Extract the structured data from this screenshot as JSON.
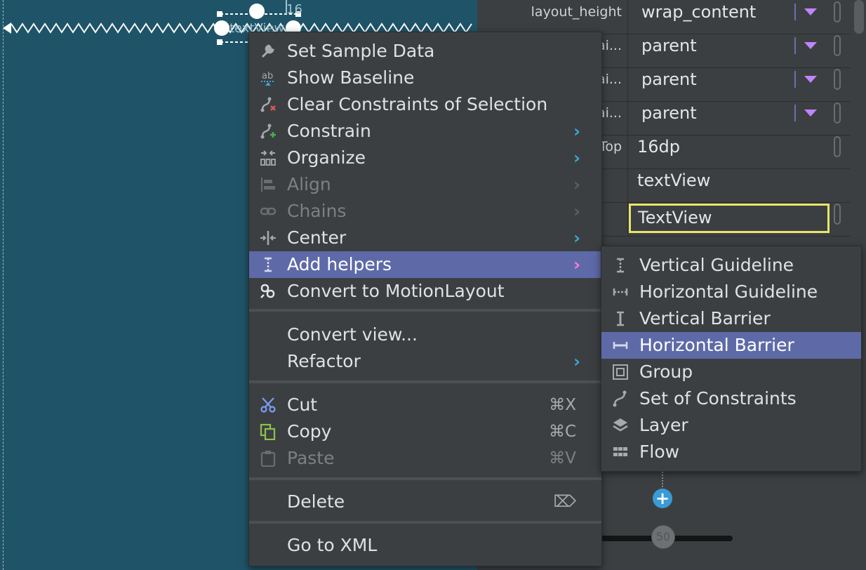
{
  "canvas": {
    "selected_label": "textView",
    "margin_label": "16"
  },
  "properties": {
    "rows": [
      {
        "name": "layout_height",
        "value": "wrap_content",
        "dropdown": true,
        "pill": true
      },
      {
        "name": "ai...",
        "value": "parent",
        "dropdown": true,
        "pill": true
      },
      {
        "name": "ai...",
        "value": "parent",
        "dropdown": true,
        "pill": true
      },
      {
        "name": "ai...",
        "value": "parent",
        "dropdown": true,
        "pill": true
      },
      {
        "name": "Top",
        "value": "16dp",
        "dropdown": false,
        "pill": true
      },
      {
        "name": "",
        "value": "textView",
        "dropdown": false,
        "pill": false
      },
      {
        "name": "",
        "value": "TextView",
        "dropdown": false,
        "pill": true,
        "editing": true
      }
    ],
    "slider_value": "50",
    "add_symbol": "+"
  },
  "context_menu": {
    "items": [
      {
        "label": "Set Sample Data",
        "icon": "wrench-icon",
        "glyph": "🔧",
        "enabled": true
      },
      {
        "label": "Show Baseline",
        "icon": "baseline-icon",
        "glyph": "ab",
        "enabled": true
      },
      {
        "label": "Clear Constraints of Selection",
        "icon": "clear-constraints-icon",
        "glyph": "∫",
        "enabled": true
      },
      {
        "label": "Constrain",
        "icon": "constrain-icon",
        "glyph": "∫",
        "enabled": true,
        "submenu": true
      },
      {
        "label": "Organize",
        "icon": "organize-icon",
        "glyph": "⇥",
        "enabled": true,
        "submenu": true
      },
      {
        "label": "Align",
        "icon": "align-icon",
        "glyph": "▤",
        "enabled": false,
        "submenu": true
      },
      {
        "label": "Chains",
        "icon": "chains-icon",
        "glyph": "⚯",
        "enabled": false,
        "submenu": true
      },
      {
        "label": "Center",
        "icon": "center-icon",
        "glyph": "⊹",
        "enabled": true,
        "submenu": true
      },
      {
        "label": "Add helpers",
        "icon": "guideline-icon",
        "glyph": "I",
        "enabled": true,
        "submenu": true,
        "selected": true
      },
      {
        "label": "Convert to MotionLayout",
        "icon": "motion-icon",
        "glyph": "⚙",
        "enabled": true
      },
      {
        "label": "Convert view...",
        "enabled": true
      },
      {
        "label": "Refactor",
        "enabled": true,
        "submenu": true
      },
      {
        "label": "Cut",
        "icon": "scissors-icon",
        "glyph": "✂",
        "enabled": true,
        "shortcut": "⌘X"
      },
      {
        "label": "Copy",
        "icon": "copy-icon",
        "glyph": "⧉",
        "enabled": true,
        "shortcut": "⌘C"
      },
      {
        "label": "Paste",
        "icon": "paste-icon",
        "glyph": "📋",
        "enabled": false,
        "shortcut": "⌘V"
      },
      {
        "label": "Delete",
        "enabled": true,
        "shortcut": "⌦"
      },
      {
        "label": "Go to XML",
        "enabled": true
      }
    ],
    "submenu_arrow": "›"
  },
  "helpers_submenu": {
    "items": [
      {
        "label": "Vertical Guideline",
        "icon": "vertical-guideline-icon",
        "glyph": "I"
      },
      {
        "label": "Horizontal Guideline",
        "icon": "horizontal-guideline-icon",
        "glyph": "⊢⊣"
      },
      {
        "label": "Vertical Barrier",
        "icon": "vertical-barrier-icon",
        "glyph": "I"
      },
      {
        "label": "Horizontal Barrier",
        "icon": "horizontal-barrier-icon",
        "glyph": "⊢⊣",
        "selected": true
      },
      {
        "label": "Group",
        "icon": "group-icon",
        "glyph": "▣"
      },
      {
        "label": "Set of Constraints",
        "icon": "constraint-set-icon",
        "glyph": "∫"
      },
      {
        "label": "Layer",
        "icon": "layer-icon",
        "glyph": "◈"
      },
      {
        "label": "Flow",
        "icon": "flow-icon",
        "glyph": "▦"
      }
    ]
  },
  "colors": {
    "canvas_bg": "#1f5468",
    "panel_bg": "#3c3f41",
    "selection": "#5e6aa8",
    "accent_arrow": "#3da5d9",
    "dropdown": "#c084fc",
    "edit_border": "#e6e66a"
  }
}
